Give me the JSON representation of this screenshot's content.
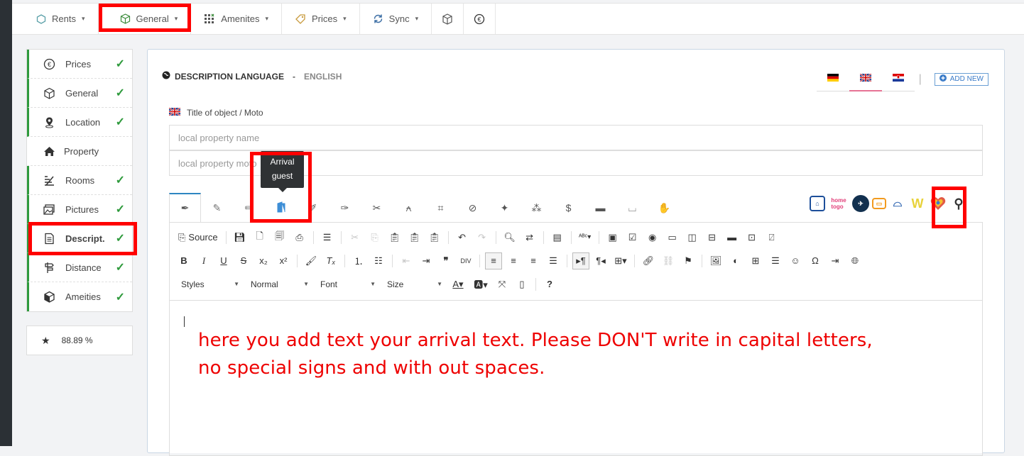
{
  "topnav": [
    {
      "label": "Rents",
      "icon": "hexagon-icon",
      "chevron": "⌄"
    },
    {
      "label": "General",
      "icon": "cube-icon",
      "chevron": "⌄"
    },
    {
      "label": "Amenites",
      "icon": "grid-icon",
      "chevron": "⌄"
    },
    {
      "label": "Prices",
      "icon": "tag-icon",
      "chevron": "⌄"
    },
    {
      "label": "Sync",
      "icon": "sync-icon",
      "chevron": "⌄"
    }
  ],
  "sidebar": {
    "items": [
      {
        "label": "Prices",
        "done": true
      },
      {
        "label": "General",
        "done": true
      },
      {
        "label": "Location",
        "done": true
      },
      {
        "label": "Property",
        "done": false
      },
      {
        "label": "Rooms",
        "done": true
      },
      {
        "label": "Pictures",
        "done": true
      },
      {
        "label": "Descript.",
        "done": true
      },
      {
        "label": "Distance",
        "done": true
      },
      {
        "label": "Ameities",
        "done": true
      }
    ],
    "score": "88.89 %"
  },
  "panel": {
    "lang_label": "DESCRIPTION LANGUAGE",
    "lang_sep": "-",
    "lang_value": "ENGLISH",
    "add_new": "ADD NEW",
    "title_label": "Title of object / Moto",
    "input1_placeholder": "local property name",
    "input2_placeholder": "local property moto",
    "tooltip_line1": "Arrival",
    "tooltip_line2": "guest"
  },
  "editor": {
    "source_label": "Source",
    "styles": "Styles",
    "format": "Normal",
    "font": "Font",
    "size": "Size",
    "note_line1": "here you add text your arrival text. Please DON'T write in capital letters,",
    "note_line2": "no special signs and with out spaces."
  },
  "colors": {
    "accent": "#2e86c1",
    "check": "#2e9a3c",
    "highlight": "#ff0000",
    "note": "#e00000"
  }
}
